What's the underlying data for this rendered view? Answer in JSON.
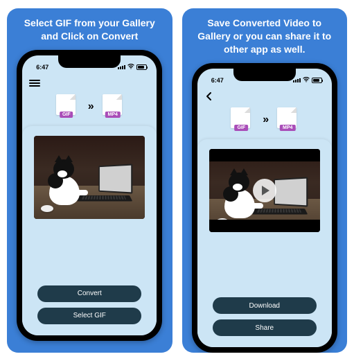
{
  "panels": [
    {
      "caption": "Select GIF from your Gallery and Click on Convert",
      "statusTime": "6:47",
      "navIcon": "hamburger",
      "srcFormat": "GIF",
      "dstFormat": "MP4",
      "hasLetterbox": false,
      "hasPlay": false,
      "button1": "Convert",
      "button2": "Select GIF"
    },
    {
      "caption": "Save Converted Video to Gallery or you can share it to other app as well.",
      "statusTime": "6:47",
      "navIcon": "back",
      "srcFormat": "GIF",
      "dstFormat": "MP4",
      "hasLetterbox": true,
      "hasPlay": true,
      "button1": "Download",
      "button2": "Share"
    }
  ]
}
